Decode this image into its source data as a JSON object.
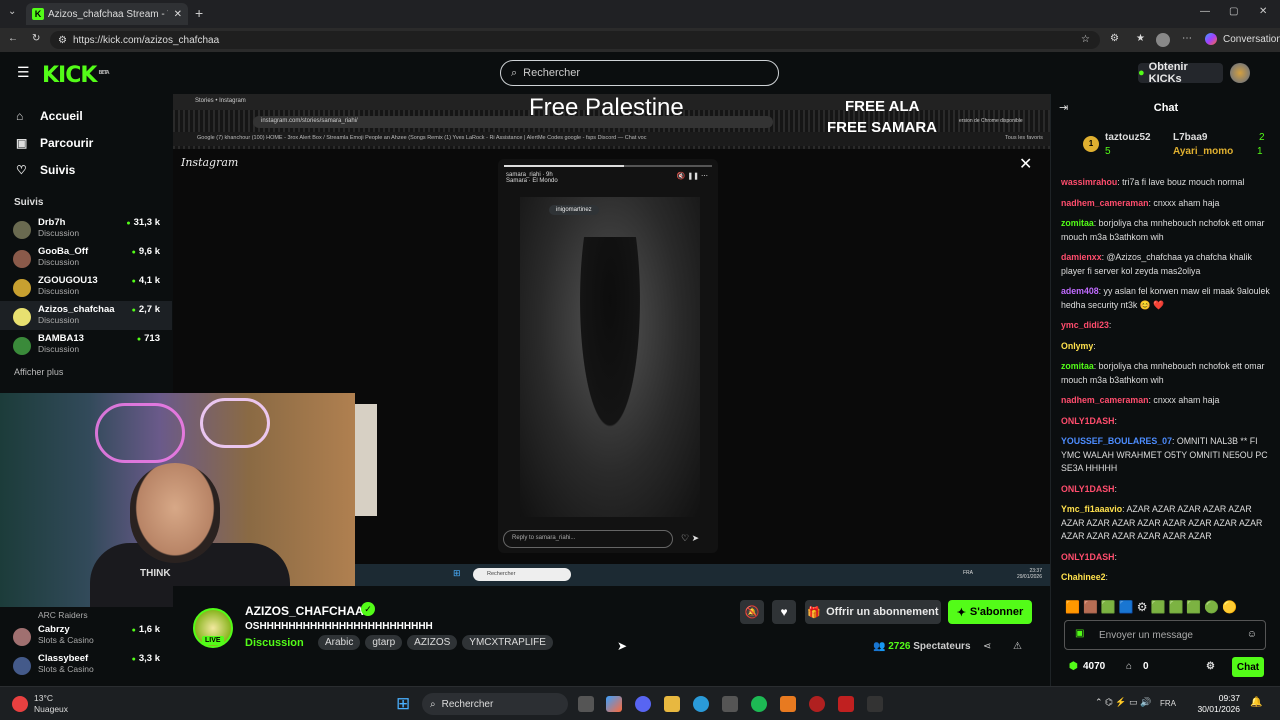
{
  "browser": {
    "tab_title": "Azizos_chafchaa Stream - Wa",
    "url": "https://kick.com/azizos_chafchaa",
    "conversation": "Conversation"
  },
  "header": {
    "logo": "KICK",
    "logo_badge": "BETA",
    "search_placeholder": "Rechercher",
    "kicks_button": "Obtenir KICKs"
  },
  "sidebar": {
    "nav": [
      {
        "label": "Accueil",
        "icon": "home-icon"
      },
      {
        "label": "Parcourir",
        "icon": "browse-icon"
      },
      {
        "label": "Suivis",
        "icon": "heart-icon"
      }
    ],
    "following_title": "Suivis",
    "following": [
      {
        "name": "Drb7h",
        "category": "Discussion",
        "viewers": "31,3 k"
      },
      {
        "name": "GooBa_Off",
        "category": "Discussion",
        "viewers": "9,6 k"
      },
      {
        "name": "ZGOUGOU13",
        "category": "Discussion",
        "viewers": "4,1 k"
      },
      {
        "name": "Azizos_chafchaa",
        "category": "Discussion",
        "viewers": "2,7 k"
      },
      {
        "name": "BAMBA13",
        "category": "Discussion",
        "viewers": "713"
      }
    ],
    "show_more": "Afficher plus",
    "lower": [
      {
        "name": "",
        "category": "ARC Raiders",
        "viewers": ""
      },
      {
        "name": "Cabrzy",
        "category": "Slots & Casino",
        "viewers": "1,6 k"
      },
      {
        "name": "Classybeef",
        "category": "Slots & Casino",
        "viewers": "3,3 k"
      }
    ]
  },
  "video": {
    "overlay_text_1": "Free Palestine",
    "overlay_text_2": "FREE ALA",
    "overlay_text_3": "FREE SAMARA",
    "inner_tab": "Stories • Instagram",
    "inner_url": "instagram.com/stories/samara_riahi/",
    "inner_bookmarks": "Google   (7) khanchour   (100) HOME - 3rox   Alert Box / Streamla   Emoji People an   Ahzee (Songs Remix   (1) Yves LaRock - Ri   Assistance | AlertMe   Codes google - fsps   Discord — Chat voc",
    "inner_update": "ersion de Chrome disponible",
    "inner_all_tabs": "Tous les favoris",
    "instagram_logo": "Instagram",
    "story_user": "samara_riahi",
    "story_time": "9h",
    "story_music": "Samara · El Mondo",
    "photo_tag": "inigomartinez",
    "reply_placeholder": "Reply to samara_riahi...",
    "inner_search": "Rechercher",
    "inner_lang": "FRA",
    "inner_time": "23:37",
    "inner_date": "29/01/2026",
    "webcam_shirt": "THINK"
  },
  "stream_info": {
    "streamer": "AZIZOS_CHAFCHAA",
    "live_label": "LIVE",
    "title": "OSHHHHHHHHHHHHHHHHHHHHHHHH",
    "category": "Discussion",
    "tags": [
      "Arabic",
      "gtarp",
      "AZIZOS",
      "YMCXTRAPLIFE"
    ],
    "gift_button": "Offrir un abonnement",
    "subscribe_button": "S'abonner",
    "viewers": "2726",
    "viewers_label": "Spectateurs"
  },
  "chat": {
    "title": "Chat",
    "top_gifters": [
      {
        "name": "taztouz52",
        "count": "5",
        "rank": "1"
      },
      {
        "name": "L7baa9",
        "count": "2"
      },
      {
        "name": "Ayari_momo",
        "count": "1"
      }
    ],
    "messages": [
      {
        "user": "wassimrahou",
        "color": "#ff4d6d",
        "text": ": tri7a fi lave bouz mouch normal"
      },
      {
        "user": "nadhem_cameraman",
        "color": "#ff4d6d",
        "text": ": cnxxx aham haja"
      },
      {
        "user": "zomitaa",
        "color": "#53fc18",
        "text": ": borjoliya cha mnhebouch nchofok ett omar mouch m3a b3athkom wih"
      },
      {
        "user": "damienxx",
        "color": "#ff4d6d",
        "text": ": @Azizos_chafchaa ya chafcha khalik player fi server kol zeyda mas2oliya"
      },
      {
        "user": "adem408",
        "color": "#c06bff",
        "text": ": yy aslan fel korwen maw eli maak 9aloulek hedha security nt3k 😊 ❤️"
      },
      {
        "user": "ymc_didi23",
        "color": "#ff4d6d",
        "text": ": "
      },
      {
        "user": "Onlymy",
        "color": "#ffe14d",
        "text": ": "
      },
      {
        "user": "zomitaa",
        "color": "#53fc18",
        "text": ": borjoliya cha mnhebouch nchofok ett omar mouch m3a b3athkom wih"
      },
      {
        "user": "nadhem_cameraman",
        "color": "#ff4d6d",
        "text": ": cnxxx aham haja"
      },
      {
        "user": "ONLY1DASH",
        "color": "#ff4d6d",
        "text": ": "
      },
      {
        "user": "YOUSSEF_BOULARES_07",
        "color": "#4d8dff",
        "text": ": OMNITI NAL3B ** FI YMC WALAH WRAHMET O5TY OMNITI NE5OU PC SE3A HHHHH"
      },
      {
        "user": "ONLY1DASH",
        "color": "#ff4d6d",
        "text": ": "
      },
      {
        "user": "Ymc_fi1aaavio",
        "color": "#ffe14d",
        "text": ": AZAR AZAR AZAR AZAR AZAR AZAR AZAR AZAR AZAR AZAR AZAR AZAR AZAR AZAR AZAR AZAR AZAR AZAR AZAR"
      },
      {
        "user": "ONLY1DASH",
        "color": "#ff4d6d",
        "text": ": "
      },
      {
        "user": "Chahinee2",
        "color": "#ffe14d",
        "text": ": "
      }
    ],
    "input_placeholder": "Envoyer un message",
    "points": "4070",
    "gift_count": "0",
    "send_button": "Chat"
  },
  "os": {
    "weather_temp": "13°C",
    "weather_desc": "Nuageux",
    "search": "Rechercher",
    "lang": "FRA",
    "time": "09:37",
    "date": "30/01/2026"
  },
  "colors": {
    "accent": "#53fc18",
    "background": "#0b0e0f"
  }
}
